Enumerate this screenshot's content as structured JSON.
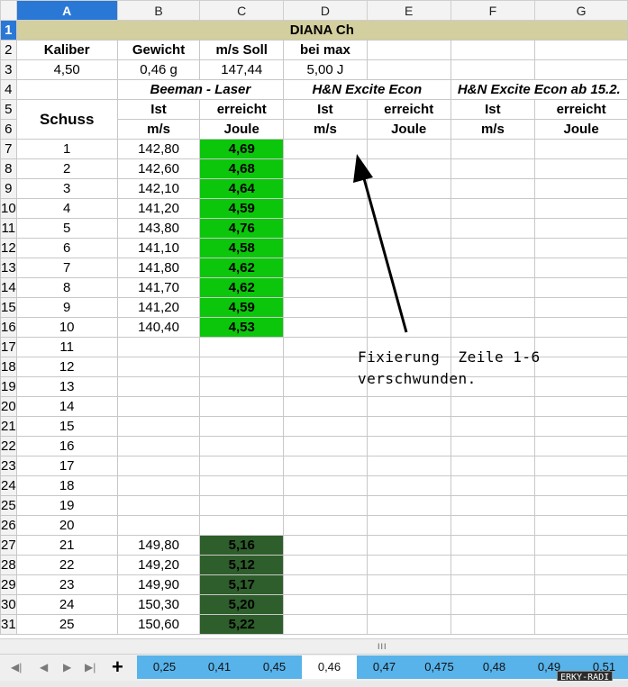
{
  "columns": [
    "A",
    "B",
    "C",
    "D",
    "E",
    "F",
    "G"
  ],
  "selected_column": "A",
  "selected_row": "1",
  "title": "DIANA Ch",
  "header_row": {
    "kaliber": "Kaliber",
    "gewicht": "Gewicht",
    "ms_soll": "m/s Soll",
    "bei_max": "bei max"
  },
  "values_row": {
    "kaliber": "4,50",
    "gewicht": "0,46 g",
    "ms_soll": "147,44",
    "bei_max": "5,00 J"
  },
  "groups": {
    "beeman": "Beeman - Laser",
    "hn_econ": "H&N Excite Econ",
    "hn_econ_15": "H&N Excite Econ ab 15.2."
  },
  "subheaders": {
    "schuss": "Schuss",
    "ist": "Ist",
    "ms": "m/s",
    "erreicht": "erreicht",
    "joule": "Joule"
  },
  "shots": [
    {
      "row": "7",
      "schuss": "1",
      "ms": "142,80",
      "joule": "4,69"
    },
    {
      "row": "8",
      "schuss": "2",
      "ms": "142,60",
      "joule": "4,68"
    },
    {
      "row": "9",
      "schuss": "3",
      "ms": "142,10",
      "joule": "4,64"
    },
    {
      "row": "10",
      "schuss": "4",
      "ms": "141,20",
      "joule": "4,59"
    },
    {
      "row": "11",
      "schuss": "5",
      "ms": "143,80",
      "joule": "4,76"
    },
    {
      "row": "12",
      "schuss": "6",
      "ms": "141,10",
      "joule": "4,58"
    },
    {
      "row": "13",
      "schuss": "7",
      "ms": "141,80",
      "joule": "4,62"
    },
    {
      "row": "14",
      "schuss": "8",
      "ms": "141,70",
      "joule": "4,62"
    },
    {
      "row": "15",
      "schuss": "9",
      "ms": "141,20",
      "joule": "4,59"
    },
    {
      "row": "16",
      "schuss": "10",
      "ms": "140,40",
      "joule": "4,53"
    },
    {
      "row": "17",
      "schuss": "11",
      "ms": "",
      "joule": ""
    },
    {
      "row": "18",
      "schuss": "12",
      "ms": "",
      "joule": ""
    },
    {
      "row": "19",
      "schuss": "13",
      "ms": "",
      "joule": ""
    },
    {
      "row": "20",
      "schuss": "14",
      "ms": "",
      "joule": ""
    },
    {
      "row": "21",
      "schuss": "15",
      "ms": "",
      "joule": ""
    },
    {
      "row": "22",
      "schuss": "16",
      "ms": "",
      "joule": ""
    },
    {
      "row": "23",
      "schuss": "17",
      "ms": "",
      "joule": ""
    },
    {
      "row": "24",
      "schuss": "18",
      "ms": "",
      "joule": ""
    },
    {
      "row": "25",
      "schuss": "19",
      "ms": "",
      "joule": ""
    },
    {
      "row": "26",
      "schuss": "20",
      "ms": "",
      "joule": ""
    },
    {
      "row": "27",
      "schuss": "21",
      "ms": "149,80",
      "joule": "5,16"
    },
    {
      "row": "28",
      "schuss": "22",
      "ms": "149,20",
      "joule": "5,12"
    },
    {
      "row": "29",
      "schuss": "23",
      "ms": "149,90",
      "joule": "5,17"
    },
    {
      "row": "30",
      "schuss": "24",
      "ms": "150,30",
      "joule": "5,20"
    },
    {
      "row": "31",
      "schuss": "25",
      "ms": "150,60",
      "joule": "5,22"
    }
  ],
  "annotation": {
    "line1": "Fixierung  Zeile 1-6",
    "line2": "verschwunden."
  },
  "scrollbar_grip": "III",
  "navigation": {
    "first": "◀|",
    "prev": "◀",
    "next": "▶",
    "last": "▶|",
    "add_sheet": "+"
  },
  "sheet_tabs": [
    "0,25",
    "0,41",
    "0,45",
    "0,46",
    "0,47",
    "0,475",
    "0,48",
    "0,49",
    "0,51"
  ],
  "active_tab": "0,46",
  "watermark": "ERKY-RADI",
  "colors": {
    "green": "#0cc60c",
    "dark_green": "#2e5e2b",
    "title_bg": "#d3cf9e",
    "group_text": "#0b2bd9",
    "tab_bar": "#58b3ea",
    "selection": "#2a78d6"
  }
}
